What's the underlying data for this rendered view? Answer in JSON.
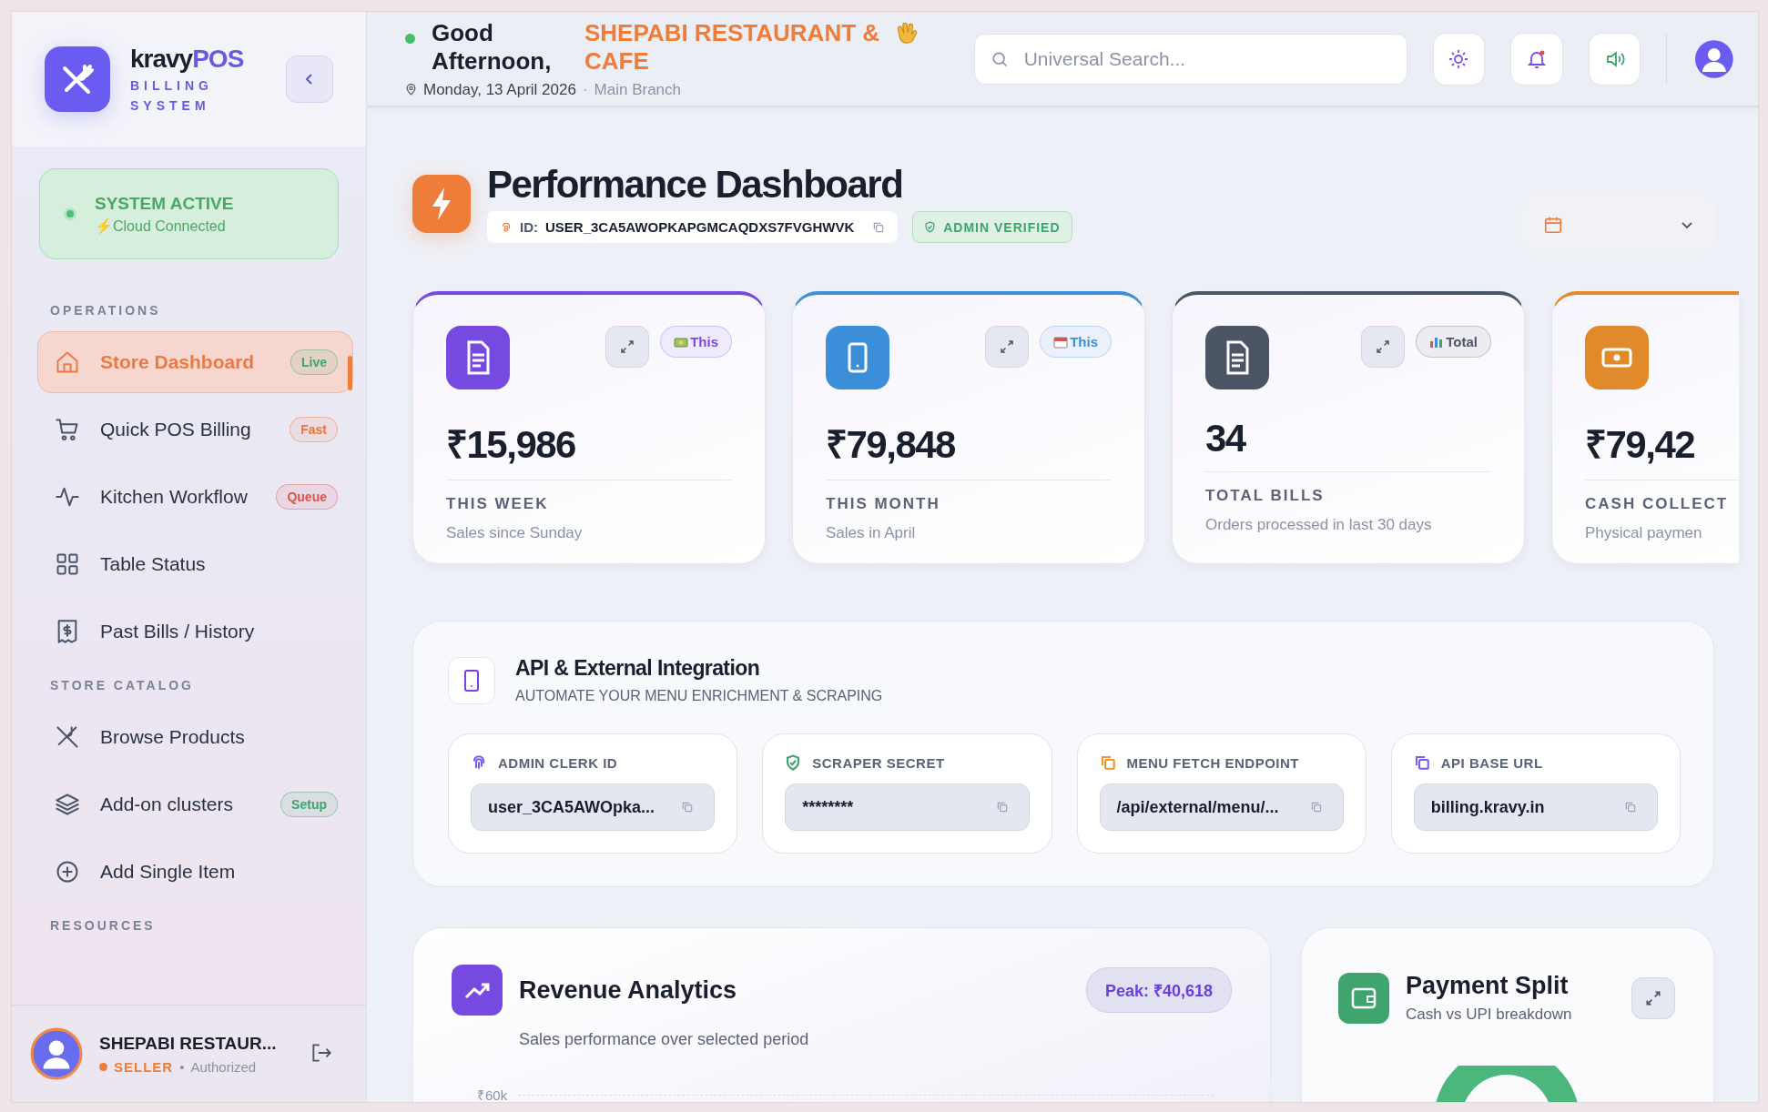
{
  "sidebar": {
    "brand": {
      "name_main": "kravy",
      "name_accent": "POS",
      "tagline": "BILLING SYSTEM"
    },
    "status": {
      "title": "SYSTEM ACTIVE",
      "subtitle": "⚡Cloud Connected"
    },
    "sections": [
      {
        "heading": "OPERATIONS",
        "items": [
          {
            "label": "Store Dashboard",
            "selected": true,
            "badge": {
              "text": "Live",
              "color": "#3da56b"
            }
          },
          {
            "label": "Quick POS Billing",
            "selected": false,
            "badge": {
              "text": "Fast",
              "color": "#e8763c"
            }
          },
          {
            "label": "Kitchen Workflow",
            "selected": false,
            "badge": {
              "text": "Queue",
              "color": "#d9534f"
            }
          },
          {
            "label": "Table Status",
            "selected": false
          },
          {
            "label": "Past Bills / History",
            "selected": false
          }
        ]
      },
      {
        "heading": "STORE CATALOG",
        "items": [
          {
            "label": "Browse Products",
            "selected": false
          },
          {
            "label": "Add-on clusters",
            "selected": false,
            "badge": {
              "text": "Setup",
              "color": "#3da56b"
            }
          },
          {
            "label": "Add Single Item",
            "selected": false
          }
        ]
      },
      {
        "heading": "RESOURCES"
      }
    ],
    "user": {
      "name": "SHEPABI RESTAUR...",
      "role": "SELLER",
      "separator": "•",
      "status": "Authorized"
    }
  },
  "header": {
    "greeting": "Good Afternoon,",
    "business": "SHEPABI RESTAURANT & CAFE",
    "date": "Monday, 13 April 2026",
    "separator": "·",
    "branch": "Main Branch",
    "search": {
      "placeholder": "Universal Search..."
    }
  },
  "dashboard": {
    "title": "Performance Dashboard",
    "id_label": "ID:",
    "id_value": "USER_3CA5AWOPKAPGMCAQDXS7FVGHWVK",
    "verified": "ADMIN VERIFIED"
  },
  "stats": [
    {
      "value": "₹15,986",
      "label": "THIS WEEK",
      "sub": "Sales since Sunday",
      "tag": "This",
      "color": "#7649e0"
    },
    {
      "value": "₹79,848",
      "label": "THIS MONTH",
      "sub": "Sales in April",
      "tag": "This",
      "color": "#3a8fd8"
    },
    {
      "value": "34",
      "label": "TOTAL BILLS",
      "sub": "Orders processed in last 30 days",
      "tag": "Total",
      "color": "#4b5565"
    },
    {
      "value": "₹79,42",
      "label": "CASH COLLECT",
      "sub": "Physical paymen",
      "color": "#e08a2c"
    }
  ],
  "integration": {
    "title": "API & External Integration",
    "subtitle": "AUTOMATE YOUR MENU ENRICHMENT & SCRAPING",
    "fields": [
      {
        "label": "ADMIN CLERK ID",
        "value": "user_3CA5AWOpka...",
        "color": "#7b5cf0"
      },
      {
        "label": "SCRAPER SECRET",
        "value": "********",
        "color": "#3da56b"
      },
      {
        "label": "MENU FETCH ENDPOINT",
        "value": "/api/external/menu/...",
        "color": "#f0932b"
      },
      {
        "label": "API BASE URL",
        "value": "billing.kravy.in",
        "color": "#7b5cf0"
      }
    ]
  },
  "revenue": {
    "title": "Revenue Analytics",
    "subtitle": "Sales performance over selected period",
    "peak": "Peak: ₹40,618",
    "tick": "₹60k"
  },
  "payment": {
    "title": "Payment Split",
    "subtitle": "Cash vs UPI breakdown"
  }
}
